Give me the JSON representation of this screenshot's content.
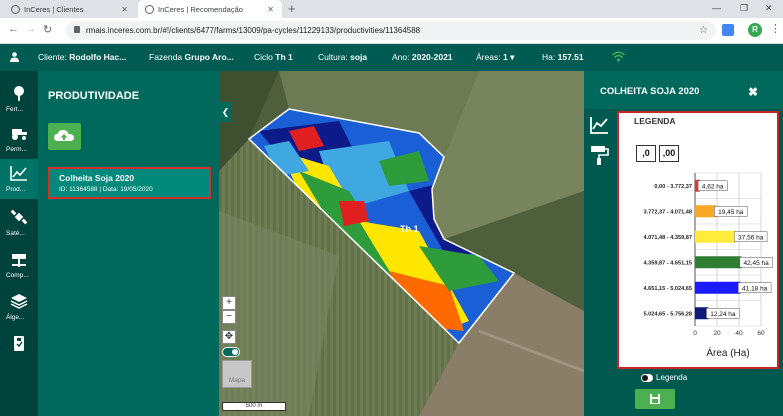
{
  "browser": {
    "tabs": [
      {
        "title": "InCeres | Clientes"
      },
      {
        "title": "InCeres | Recomendação"
      }
    ],
    "url": "rmais.inceres.com.br/#!/clients/6477/farms/13009/pa-cycles/11229133/productivities/11364588",
    "profile_initial": "R"
  },
  "appbar": {
    "cliente_label": "Cliente:",
    "cliente": "Rodolfo Hac...",
    "fazenda_label": "Fazenda",
    "fazenda": "Grupo Aro...",
    "ciclo_label": "Ciclo",
    "ciclo": "Th 1",
    "cultura_label": "Cultura:",
    "cultura": "soja",
    "ano_label": "Ano:",
    "ano": "2020-2021",
    "areas_label": "Áreas:",
    "areas": "1",
    "ha_label": "Ha:",
    "ha": "157.51"
  },
  "sidebar": {
    "items": [
      {
        "label": "Fert...",
        "icon": "fertility-icon"
      },
      {
        "label": "Perm...",
        "icon": "tractor-icon"
      },
      {
        "label": "Prod...",
        "icon": "chart-line-icon"
      },
      {
        "label": "Saté...",
        "icon": "satellite-icon"
      },
      {
        "label": "Comp...",
        "icon": "planter-icon"
      },
      {
        "label": "Álge...",
        "icon": "layers-icon"
      },
      {
        "label": "",
        "icon": "clipboard-icon"
      }
    ]
  },
  "panel": {
    "title": "PRODUTIVIDADE",
    "upload_icon": "cloud-upload-icon",
    "card": {
      "name": "Colheita Soja 2020",
      "meta": "ID: 11364588 | Data: 19/05/2020"
    }
  },
  "map": {
    "field_label": "Th 1",
    "zoom_in": "+",
    "zoom_out": "−",
    "mapa_label": "Mapa",
    "scale": "500 m"
  },
  "right_panel": {
    "title": "COLHEITA SOJA 2020",
    "close": "✖",
    "legend_title": "LEGENDA",
    "decimal_buttons": [
      ",0",
      ",00"
    ],
    "legend_toggle_label": "Legenda"
  },
  "chart_data": {
    "type": "bar",
    "orientation": "horizontal",
    "categories": [
      "0,00 - 3.772,37",
      "3.772,37 - 4.071,48",
      "4.071,48 - 4.359,87",
      "4.359,87 - 4.651,15",
      "4.651,15 - 5.024,65",
      "5.024,65 - 5.756,28"
    ],
    "values": [
      4.62,
      19.45,
      37.56,
      42.45,
      41.18,
      12.24
    ],
    "value_labels": [
      "4,62 ha",
      "19,45 ha",
      "37,56 ha",
      "42,45 ha",
      "41,18 ha",
      "12,24 ha"
    ],
    "colors": [
      "#e53935",
      "#f9a825",
      "#ffeb3b",
      "#2e7d32",
      "#1a1aff",
      "#0d1a7a"
    ],
    "xlabel": "Área (Ha)",
    "xlim": [
      0,
      60
    ],
    "xticks": [
      0,
      20,
      40,
      60
    ],
    "grid": true
  }
}
